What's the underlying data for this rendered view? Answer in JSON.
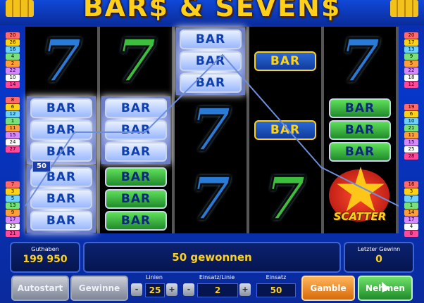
{
  "game": {
    "title": "BAR$ & SEVEN$"
  },
  "reels": [
    {
      "symbols": [
        {
          "type": "seven",
          "color": "blue"
        },
        {
          "type": "bar3",
          "color": "white",
          "lit": true
        },
        {
          "type": "bar3",
          "color": "white",
          "lit": true
        }
      ]
    },
    {
      "symbols": [
        {
          "type": "seven",
          "color": "green"
        },
        {
          "type": "bar3",
          "color": "white",
          "lit": true
        },
        {
          "type": "bar3",
          "color": "green"
        }
      ]
    },
    {
      "symbols": [
        {
          "type": "bar3",
          "color": "white",
          "lit": true
        },
        {
          "type": "seven",
          "color": "blue"
        },
        {
          "type": "seven",
          "color": "blue"
        }
      ]
    },
    {
      "symbols": [
        {
          "type": "bar1",
          "color": "blue"
        },
        {
          "type": "bar1",
          "color": "blue"
        },
        {
          "type": "seven",
          "color": "green"
        }
      ]
    },
    {
      "symbols": [
        {
          "type": "seven",
          "color": "blue"
        },
        {
          "type": "bar3",
          "color": "green"
        },
        {
          "type": "scatter"
        }
      ]
    }
  ],
  "bar_label": "BAR",
  "seven_label": "7",
  "scatter_label": "SCATTER",
  "win_line_marker": "50",
  "left_line_numbers": [
    "20",
    "26",
    "16",
    "4",
    "2",
    "22",
    "10",
    "14",
    "8",
    "6",
    "12",
    "1",
    "11",
    "15",
    "24",
    "27",
    "7",
    "3",
    "5",
    "13",
    "9",
    "17",
    "23",
    "21"
  ],
  "right_line_numbers": [
    "20",
    "17",
    "13",
    "9",
    "5",
    "22",
    "18",
    "12",
    "19",
    "6",
    "10",
    "21",
    "11",
    "15",
    "25",
    "28",
    "16",
    "3",
    "7",
    "1",
    "14",
    "17",
    "4",
    "8"
  ],
  "info": {
    "balance_label": "Guthaben",
    "balance_value": "199 950",
    "message": "50 gewonnen",
    "last_win_label": "Letzter Gewinn",
    "last_win_value": "0"
  },
  "controls": {
    "autostart": "Autostart",
    "gewinne": "Gewinne",
    "lines_label": "Linien",
    "lines_value": "25",
    "bet_per_line_label": "Einsatz/Linie",
    "bet_per_line_value": "2",
    "total_bet_label": "Einsatz",
    "total_bet_value": "50",
    "gamble": "Gamble",
    "take": "Nehmen",
    "minus": "-",
    "plus": "+"
  },
  "colors": {
    "frame_blue": "#0637c9",
    "gold": "#ffd21a",
    "seven_blue": "#2a7ad8",
    "seven_green": "#3cbf3c"
  }
}
